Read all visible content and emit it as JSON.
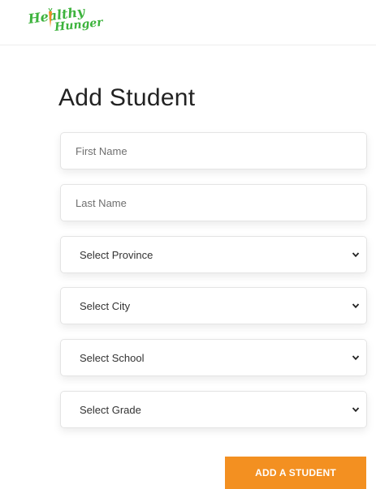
{
  "header": {
    "logo_line1": "Healthy",
    "logo_line2": "Hunger"
  },
  "page_title": "Add Student",
  "form": {
    "first_name_placeholder": "First Name",
    "last_name_placeholder": "Last Name",
    "province_select": "Select Province",
    "city_select": "Select City",
    "school_select": "Select School",
    "grade_select": "Select Grade"
  },
  "submit_label": "ADD A STUDENT",
  "icons": {
    "chevron": "chevron-down-icon"
  },
  "colors": {
    "brand_green": "#3db33d",
    "accent_orange": "#f39021"
  }
}
